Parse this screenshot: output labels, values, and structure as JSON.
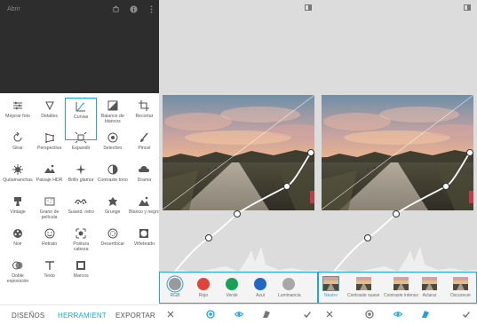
{
  "editor": {
    "title": "Abrir",
    "top_icons": [
      "info-icon",
      "more-vert-icon"
    ],
    "tools": [
      {
        "label": "Mejorar foto",
        "icon": "tune-icon"
      },
      {
        "label": "Detalles",
        "icon": "triangle-icon"
      },
      {
        "label": "Curvas",
        "icon": "curves-icon",
        "selected": true
      },
      {
        "label": "Balance de blancos",
        "icon": "white-balance-icon"
      },
      {
        "label": "Recortar",
        "icon": "crop-icon"
      },
      {
        "label": "Girar",
        "icon": "rotate-icon"
      },
      {
        "label": "Perspectiva",
        "icon": "perspective-icon"
      },
      {
        "label": "Expandir",
        "icon": "expand-icon"
      },
      {
        "label": "Selectivo",
        "icon": "selective-icon"
      },
      {
        "label": "Pincel",
        "icon": "brush-icon"
      },
      {
        "label": "Quitamanchas",
        "icon": "healing-icon"
      },
      {
        "label": "Paisaje HDR",
        "icon": "hdr-icon"
      },
      {
        "label": "Brillo glamur",
        "icon": "glamour-icon"
      },
      {
        "label": "Contraste tono",
        "icon": "tonal-contrast-icon"
      },
      {
        "label": "Drama",
        "icon": "drama-icon"
      },
      {
        "label": "Vintage",
        "icon": "vintage-icon"
      },
      {
        "label": "Grano de película",
        "icon": "grain-icon"
      },
      {
        "label": "Suavid. retro",
        "icon": "retro-icon"
      },
      {
        "label": "Grunge",
        "icon": "grunge-icon"
      },
      {
        "label": "Blanco y negro",
        "icon": "black-white-icon"
      },
      {
        "label": "Noir",
        "icon": "noir-icon"
      },
      {
        "label": "Retrato",
        "icon": "portrait-icon"
      },
      {
        "label": "Postura cabeza",
        "icon": "head-pose-icon"
      },
      {
        "label": "Desenfocar",
        "icon": "lens-blur-icon"
      },
      {
        "label": "Viñeteado",
        "icon": "vignette-icon"
      },
      {
        "label": "Doble exposición",
        "icon": "double-exposure-icon"
      },
      {
        "label": "Texto",
        "icon": "text-icon"
      },
      {
        "label": "Marcos",
        "icon": "frames-icon"
      }
    ],
    "bottom_nav": {
      "looks": "DISEÑOS",
      "tools": "HERRAMIENT",
      "export": "EXPORTAR"
    }
  },
  "curves_channels": {
    "channels": [
      {
        "label": "RGB",
        "color": "#9a9a9a",
        "selected": true
      },
      {
        "label": "Rojo",
        "color": "#e04438"
      },
      {
        "label": "Verde",
        "color": "#19a05a"
      },
      {
        "label": "Azul",
        "color": "#2266c6"
      },
      {
        "label": "Luminancia",
        "color": "#a8a8a8"
      }
    ],
    "bottom_icons": [
      "close-icon",
      "channel-icon",
      "eye-icon",
      "styles-icon",
      "check-icon"
    ]
  },
  "curves_presets": {
    "presets": [
      {
        "label": "Neutro",
        "selected": true
      },
      {
        "label": "Contraste suave"
      },
      {
        "label": "Contraste intenso"
      },
      {
        "label": "Aclarar"
      },
      {
        "label": "Oscurecer"
      }
    ],
    "bottom_icons": [
      "close-icon",
      "channel-icon",
      "eye-icon",
      "styles-icon",
      "check-icon"
    ]
  },
  "colors": {
    "accent": "#1aa7e0",
    "background": "#dcdcdc"
  }
}
